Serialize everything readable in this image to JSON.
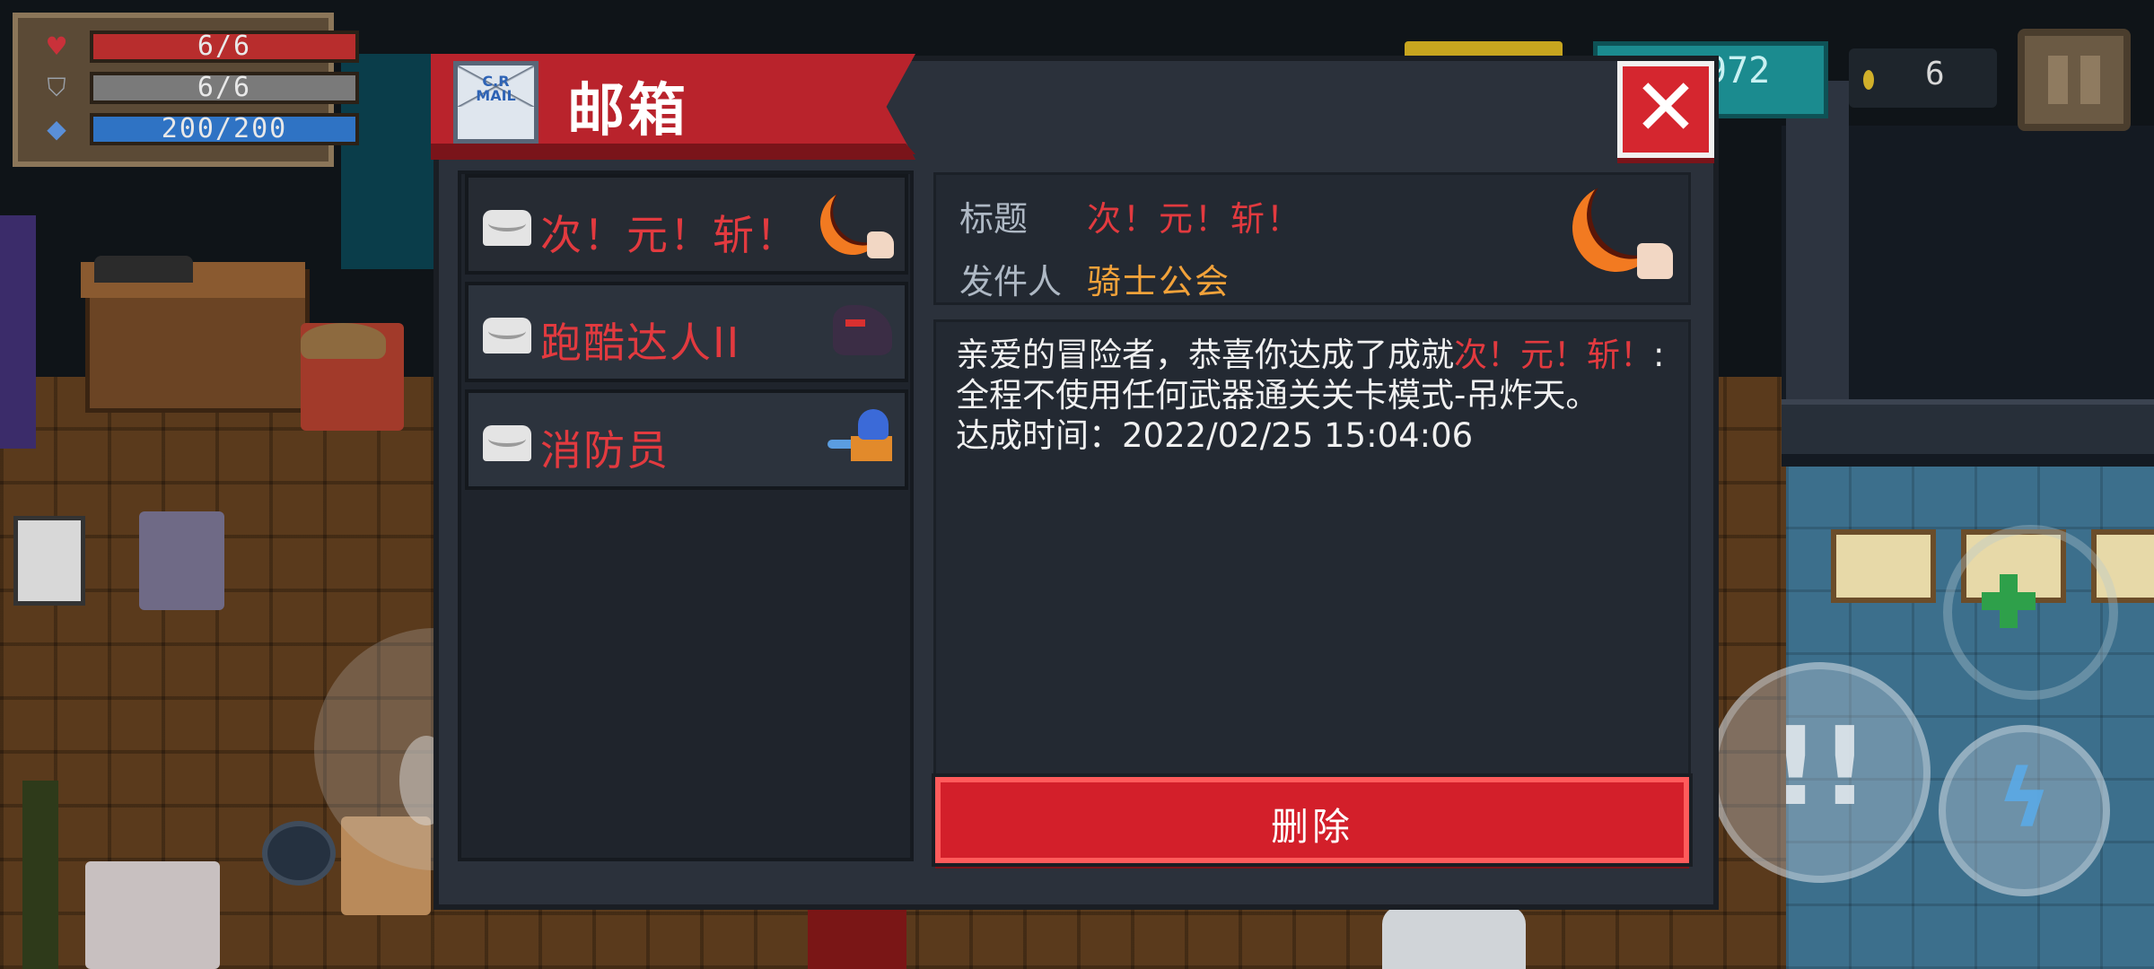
{
  "hud": {
    "hp": "6/6",
    "armor": "6/6",
    "energy": "200/200",
    "gems": "972",
    "coins": "6",
    "hp_fraction": 1.0,
    "armor_fraction": 1.0,
    "energy_fraction": 1.0
  },
  "colors": {
    "accent_red": "#d31f2a",
    "highlight_red": "#e23a3f",
    "sender_orange": "#f2a23a",
    "panel_dark": "#2b313b"
  },
  "mailbox": {
    "title": "邮箱",
    "icon_label": "C.R MAIL",
    "items": [
      {
        "label": "次！元！斩！",
        "icon": "crescent-blade-icon"
      },
      {
        "label": "跑酷达人II",
        "icon": "ninja-icon"
      },
      {
        "label": "消防员",
        "icon": "fireman-icon"
      }
    ],
    "detail": {
      "title_label": "标题",
      "title_value": "次！元！斩！",
      "sender_label": "发件人",
      "sender_value": "骑士公会",
      "body_prefix": "亲爱的冒险者，恭喜你达成了成就",
      "body_achievement": "次！元！斩！",
      "body_suffix": ":全程不使用任何武器通关关卡模式-吊炸天。",
      "achieved_time": "达成时间：2022/02/25 15:04:06"
    },
    "delete_label": "删除",
    "close_icon": "close-icon"
  }
}
